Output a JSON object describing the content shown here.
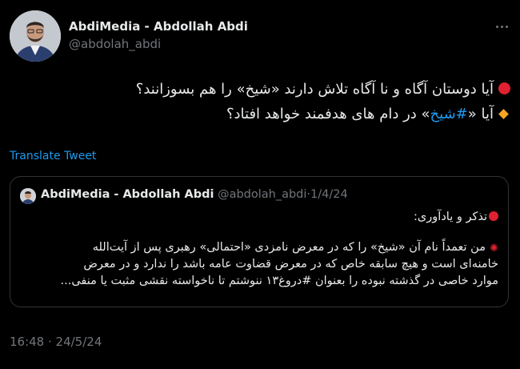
{
  "author": {
    "name": "AbdiMedia - Abdollah Abdi",
    "handle": "@abdolah_abdi"
  },
  "tweet": {
    "line1": "آیا دوستان آگاه و نا آگاه تلاش دارند «شیخ» را هم بسوزانند؟",
    "line2_prefix": "آیا «",
    "line2_hashtag": "#شیخ",
    "line2_suffix": "» در دام های هدفمند خواهد افتاد؟"
  },
  "translate_label": "Translate Tweet",
  "quote": {
    "name": "AbdiMedia - Abdollah Abdi",
    "handle": "@abdolah_abdi",
    "separator": "·",
    "date": "1/4/24",
    "heading": "تذکر و یادآوری:",
    "text_line1": "من تعمداً نام آن «شیخ» را که در معرض نامزدی «احتمالی» رهبری پس از آیت‌الله",
    "text_line2": "خامنه‌ای است و هیچ سابقه خاص که در معرض قضاوت عامه باشد را ندارد و در معرض",
    "text_line3": "موارد خاصی در گذشته نبوده را بعنوان #دروغ۱۳ ننوشتم تا ناخواسته نقشی مثبت یا منفی..."
  },
  "timestamp": "16:48 · 24/5/24",
  "icons": {
    "more": "more-options-icon",
    "bullet_red": "red-circle-icon",
    "bullet_orange": "orange-diamond-icon",
    "anger": "anger-symbol-icon"
  },
  "colors": {
    "background": "#000000",
    "text": "#e7e9ea",
    "muted": "#71767b",
    "link": "#1d9bf0",
    "border": "#2f3336",
    "red": "#e0212f",
    "orange": "#f6a623"
  }
}
